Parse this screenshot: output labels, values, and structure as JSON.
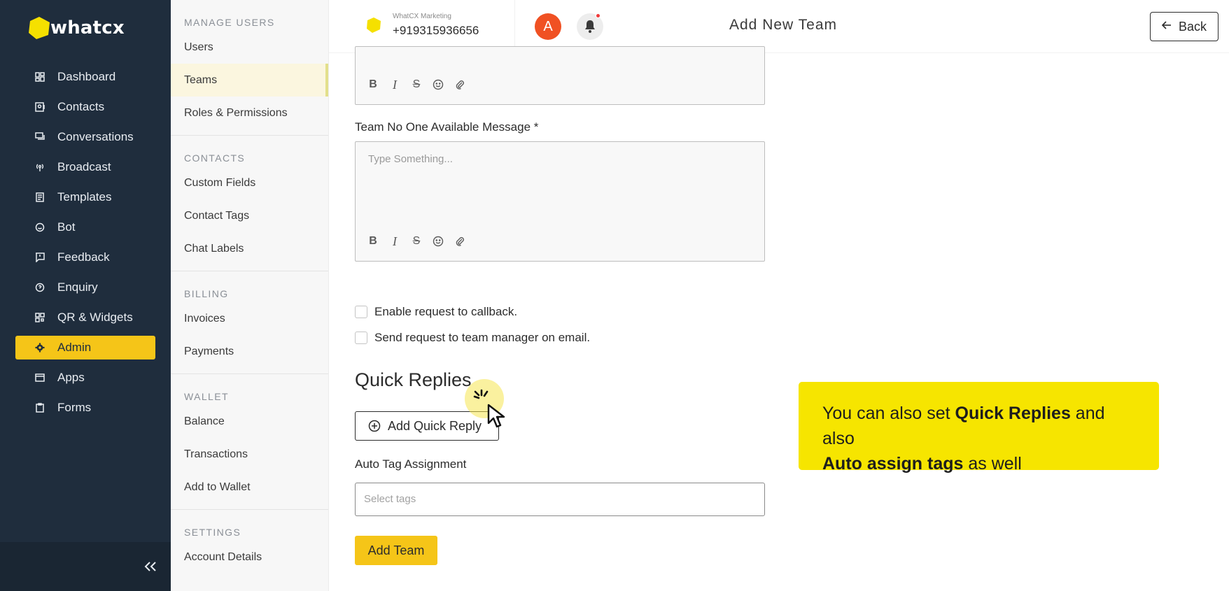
{
  "brand": {
    "logo_text": "whatcx",
    "accent": "#f5c518",
    "sidebar_bg": "#1f2d3d"
  },
  "sidebar": {
    "items": [
      {
        "label": "Dashboard",
        "icon": "dashboard-icon"
      },
      {
        "label": "Contacts",
        "icon": "contacts-icon"
      },
      {
        "label": "Conversations",
        "icon": "conversations-icon"
      },
      {
        "label": "Broadcast",
        "icon": "broadcast-icon"
      },
      {
        "label": "Templates",
        "icon": "templates-icon"
      },
      {
        "label": "Bot",
        "icon": "bot-icon"
      },
      {
        "label": "Feedback",
        "icon": "feedback-icon"
      },
      {
        "label": "Enquiry",
        "icon": "enquiry-icon"
      },
      {
        "label": "QR & Widgets",
        "icon": "qr-icon"
      },
      {
        "label": "Admin",
        "icon": "gear-icon",
        "active": true
      },
      {
        "label": "Apps",
        "icon": "apps-icon"
      },
      {
        "label": "Forms",
        "icon": "forms-icon"
      }
    ],
    "collapse_icon": "double-chevron-left-icon"
  },
  "submenu": {
    "sections": [
      {
        "heading": "MANAGE USERS",
        "items": [
          "Users",
          "Teams",
          "Roles & Permissions"
        ]
      },
      {
        "heading": "CONTACTS",
        "items": [
          "Custom Fields",
          "Contact Tags",
          "Chat Labels"
        ]
      },
      {
        "heading": "BILLING",
        "items": [
          "Invoices",
          "Payments"
        ]
      },
      {
        "heading": "WALLET",
        "items": [
          "Balance",
          "Transactions",
          "Add to Wallet"
        ]
      },
      {
        "heading": "SETTINGS",
        "items": [
          "Account Details"
        ]
      }
    ],
    "active_item": "Teams"
  },
  "header": {
    "account_name": "WhatCX Marketing",
    "account_phone": "+919315936656",
    "avatar_letter": "A",
    "title": "Add New Team",
    "back_label": "Back"
  },
  "form": {
    "editor1_placeholder": "",
    "no_one_label": "Team No One Available Message *",
    "editor2_placeholder": "Type Something...",
    "toolbar": {
      "bold": "B",
      "italic": "I",
      "strike": "S"
    },
    "checkbox_callback": "Enable request to callback.",
    "checkbox_email": "Send request to team manager on email.",
    "quick_replies_title": "Quick Replies",
    "add_quick_reply": "Add Quick Reply",
    "auto_tag_label": "Auto Tag Assignment",
    "select_tags_placeholder": "Select tags",
    "add_team": "Add Team"
  },
  "callout": {
    "line1_pre": "You can also set ",
    "line1_bold": "Quick Replies",
    "line1_post": " and also",
    "line2_bold": "Auto assign tags",
    "line2_post": " as well",
    "bg": "#f6e500"
  }
}
